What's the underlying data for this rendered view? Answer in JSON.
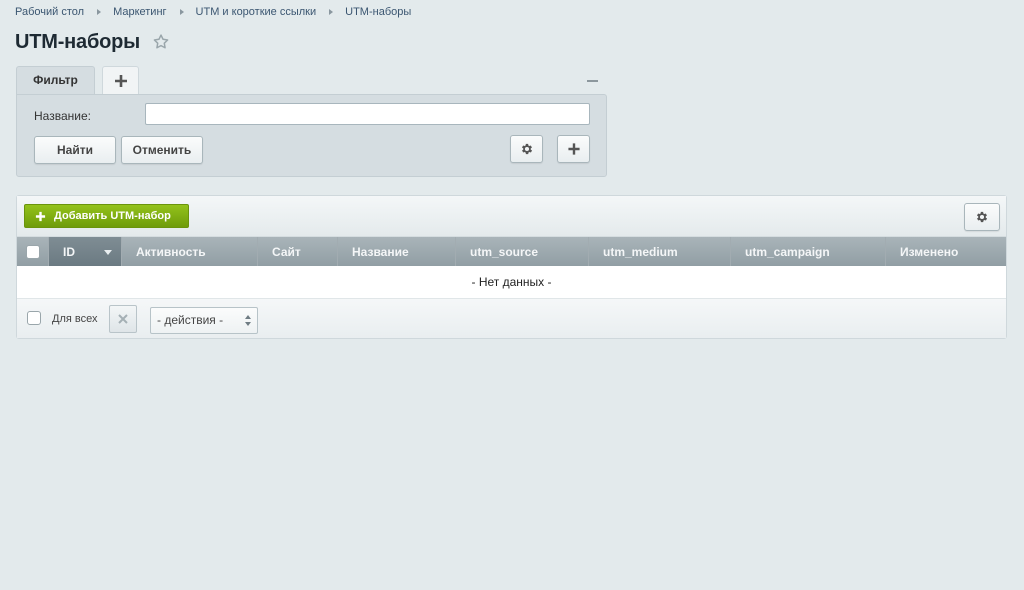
{
  "breadcrumb": [
    "Рабочий стол",
    "Маркетинг",
    "UTM и короткие ссылки",
    "UTM-наборы"
  ],
  "page": {
    "title": "UTM-наборы"
  },
  "filter": {
    "tab_label": "Фильтр",
    "name_label": "Название:",
    "name_value": "",
    "find_label": "Найти",
    "cancel_label": "Отменить"
  },
  "grid": {
    "add_label": "Добавить UTM-набор",
    "columns": [
      "ID",
      "Активность",
      "Сайт",
      "Название",
      "utm_source",
      "utm_medium",
      "utm_campaign",
      "Изменено"
    ],
    "sorted_column": "ID",
    "empty_text": "- Нет данных -",
    "for_all_label": "Для всех",
    "actions_select": "- действия -"
  },
  "colors": {
    "accent_green": "#7aa810",
    "header_gray": "#9aa6ab",
    "background": "#e3eaec"
  },
  "icons": [
    "star-icon",
    "plus-icon",
    "gear-icon",
    "close-icon",
    "sort-desc-icon",
    "updown-icon"
  ]
}
